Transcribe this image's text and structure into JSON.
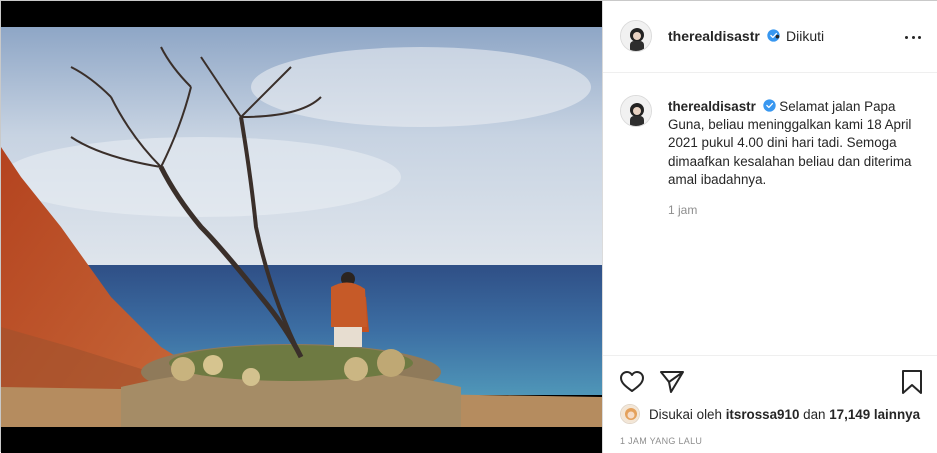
{
  "post": {
    "username": "therealdisastr",
    "separator": "•",
    "follow_status": "Diikuti",
    "caption": "Selamat jalan Papa Guna, beliau meninggalkan kami 18 April 2021 pukul 4.00 dini hari tadi. Semoga dimaafkan kesalahan beliau dan diterima amal ibadahnya.",
    "caption_time": "1 jam",
    "likes_prefix": "Disukai oleh",
    "liked_by_user": "itsrossa910",
    "likes_joiner": "dan",
    "likes_count": "17,149 lainnya",
    "posted_ago": "1 JAM YANG LALU"
  },
  "icons": {
    "like": "heart-icon",
    "share": "send-icon",
    "save": "bookmark-icon",
    "more": "more-horizontal-icon",
    "verified": "verified-badge-icon"
  },
  "colors": {
    "verified_blue": "#3897f0",
    "text": "#262626",
    "muted": "#8e8e8e"
  }
}
